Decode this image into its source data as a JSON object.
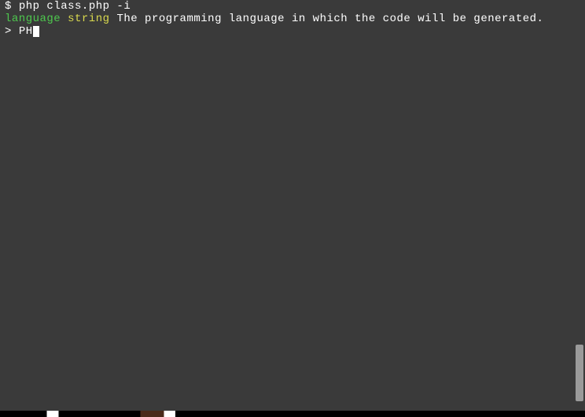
{
  "terminal": {
    "line1": {
      "prompt": "$ ",
      "command": "php class.php -i"
    },
    "line2": {
      "word1": "language",
      "word2": "string",
      "description": " The programming language in which the code will be generated."
    },
    "line3": {
      "prompt": "> ",
      "input": "PH"
    }
  }
}
